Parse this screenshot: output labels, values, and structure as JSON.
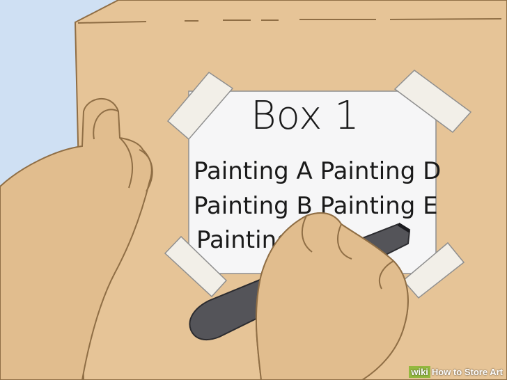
{
  "label_card": {
    "title": "Box 1",
    "line_1": "Painting A  Painting D",
    "line_2": "Painting B  Painting E",
    "line_3": "Painting"
  },
  "watermark": {
    "brand": "wiki",
    "text": "How to Store Art"
  },
  "colors": {
    "sky": "#cfe0f3",
    "cardboard": "#e6c497",
    "card": "#f6f6f7",
    "tape": "#f2efe8",
    "skin": "#e1bd8e",
    "marker": "#545459"
  },
  "icons": [
    "marker-icon",
    "tape-icon"
  ]
}
